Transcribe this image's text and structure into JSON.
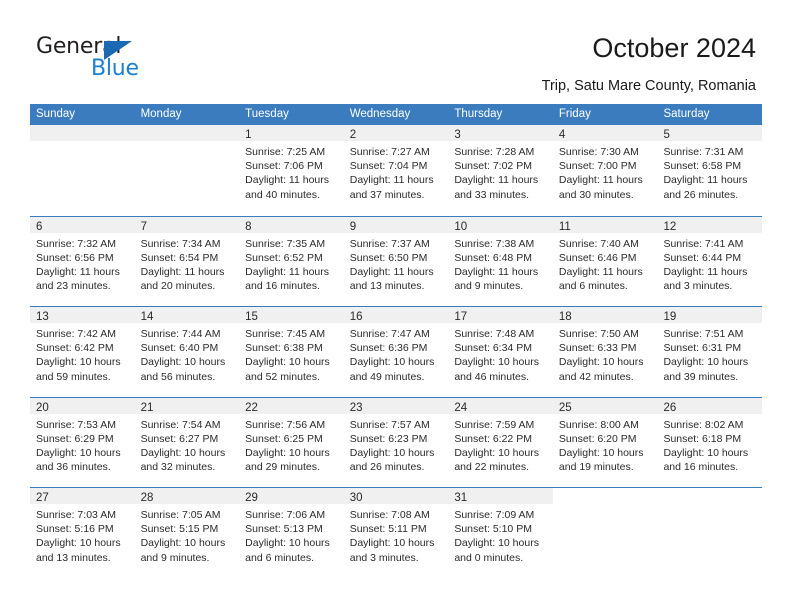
{
  "brand": {
    "name_top": "General",
    "name_bottom": "Blue",
    "accent_color": "#1b7fd4",
    "triangle_color": "#1b68b3"
  },
  "header": {
    "title": "October 2024",
    "subtitle": "Trip, Satu Mare County, Romania"
  },
  "calendar": {
    "header_bg": "#3a7cbe",
    "daynum_bg": "#f0f0f0",
    "weekday_headers": [
      "Sunday",
      "Monday",
      "Tuesday",
      "Wednesday",
      "Thursday",
      "Friday",
      "Saturday"
    ],
    "weeks": [
      [
        {
          "day": "",
          "lines": []
        },
        {
          "day": "",
          "lines": []
        },
        {
          "day": "1",
          "lines": [
            "Sunrise: 7:25 AM",
            "Sunset: 7:06 PM",
            "Daylight: 11 hours",
            "and 40 minutes."
          ]
        },
        {
          "day": "2",
          "lines": [
            "Sunrise: 7:27 AM",
            "Sunset: 7:04 PM",
            "Daylight: 11 hours",
            "and 37 minutes."
          ]
        },
        {
          "day": "3",
          "lines": [
            "Sunrise: 7:28 AM",
            "Sunset: 7:02 PM",
            "Daylight: 11 hours",
            "and 33 minutes."
          ]
        },
        {
          "day": "4",
          "lines": [
            "Sunrise: 7:30 AM",
            "Sunset: 7:00 PM",
            "Daylight: 11 hours",
            "and 30 minutes."
          ]
        },
        {
          "day": "5",
          "lines": [
            "Sunrise: 7:31 AM",
            "Sunset: 6:58 PM",
            "Daylight: 11 hours",
            "and 26 minutes."
          ]
        }
      ],
      [
        {
          "day": "6",
          "lines": [
            "Sunrise: 7:32 AM",
            "Sunset: 6:56 PM",
            "Daylight: 11 hours",
            "and 23 minutes."
          ]
        },
        {
          "day": "7",
          "lines": [
            "Sunrise: 7:34 AM",
            "Sunset: 6:54 PM",
            "Daylight: 11 hours",
            "and 20 minutes."
          ]
        },
        {
          "day": "8",
          "lines": [
            "Sunrise: 7:35 AM",
            "Sunset: 6:52 PM",
            "Daylight: 11 hours",
            "and 16 minutes."
          ]
        },
        {
          "day": "9",
          "lines": [
            "Sunrise: 7:37 AM",
            "Sunset: 6:50 PM",
            "Daylight: 11 hours",
            "and 13 minutes."
          ]
        },
        {
          "day": "10",
          "lines": [
            "Sunrise: 7:38 AM",
            "Sunset: 6:48 PM",
            "Daylight: 11 hours",
            "and 9 minutes."
          ]
        },
        {
          "day": "11",
          "lines": [
            "Sunrise: 7:40 AM",
            "Sunset: 6:46 PM",
            "Daylight: 11 hours",
            "and 6 minutes."
          ]
        },
        {
          "day": "12",
          "lines": [
            "Sunrise: 7:41 AM",
            "Sunset: 6:44 PM",
            "Daylight: 11 hours",
            "and 3 minutes."
          ]
        }
      ],
      [
        {
          "day": "13",
          "lines": [
            "Sunrise: 7:42 AM",
            "Sunset: 6:42 PM",
            "Daylight: 10 hours",
            "and 59 minutes."
          ]
        },
        {
          "day": "14",
          "lines": [
            "Sunrise: 7:44 AM",
            "Sunset: 6:40 PM",
            "Daylight: 10 hours",
            "and 56 minutes."
          ]
        },
        {
          "day": "15",
          "lines": [
            "Sunrise: 7:45 AM",
            "Sunset: 6:38 PM",
            "Daylight: 10 hours",
            "and 52 minutes."
          ]
        },
        {
          "day": "16",
          "lines": [
            "Sunrise: 7:47 AM",
            "Sunset: 6:36 PM",
            "Daylight: 10 hours",
            "and 49 minutes."
          ]
        },
        {
          "day": "17",
          "lines": [
            "Sunrise: 7:48 AM",
            "Sunset: 6:34 PM",
            "Daylight: 10 hours",
            "and 46 minutes."
          ]
        },
        {
          "day": "18",
          "lines": [
            "Sunrise: 7:50 AM",
            "Sunset: 6:33 PM",
            "Daylight: 10 hours",
            "and 42 minutes."
          ]
        },
        {
          "day": "19",
          "lines": [
            "Sunrise: 7:51 AM",
            "Sunset: 6:31 PM",
            "Daylight: 10 hours",
            "and 39 minutes."
          ]
        }
      ],
      [
        {
          "day": "20",
          "lines": [
            "Sunrise: 7:53 AM",
            "Sunset: 6:29 PM",
            "Daylight: 10 hours",
            "and 36 minutes."
          ]
        },
        {
          "day": "21",
          "lines": [
            "Sunrise: 7:54 AM",
            "Sunset: 6:27 PM",
            "Daylight: 10 hours",
            "and 32 minutes."
          ]
        },
        {
          "day": "22",
          "lines": [
            "Sunrise: 7:56 AM",
            "Sunset: 6:25 PM",
            "Daylight: 10 hours",
            "and 29 minutes."
          ]
        },
        {
          "day": "23",
          "lines": [
            "Sunrise: 7:57 AM",
            "Sunset: 6:23 PM",
            "Daylight: 10 hours",
            "and 26 minutes."
          ]
        },
        {
          "day": "24",
          "lines": [
            "Sunrise: 7:59 AM",
            "Sunset: 6:22 PM",
            "Daylight: 10 hours",
            "and 22 minutes."
          ]
        },
        {
          "day": "25",
          "lines": [
            "Sunrise: 8:00 AM",
            "Sunset: 6:20 PM",
            "Daylight: 10 hours",
            "and 19 minutes."
          ]
        },
        {
          "day": "26",
          "lines": [
            "Sunrise: 8:02 AM",
            "Sunset: 6:18 PM",
            "Daylight: 10 hours",
            "and 16 minutes."
          ]
        }
      ],
      [
        {
          "day": "27",
          "lines": [
            "Sunrise: 7:03 AM",
            "Sunset: 5:16 PM",
            "Daylight: 10 hours",
            "and 13 minutes."
          ]
        },
        {
          "day": "28",
          "lines": [
            "Sunrise: 7:05 AM",
            "Sunset: 5:15 PM",
            "Daylight: 10 hours",
            "and 9 minutes."
          ]
        },
        {
          "day": "29",
          "lines": [
            "Sunrise: 7:06 AM",
            "Sunset: 5:13 PM",
            "Daylight: 10 hours",
            "and 6 minutes."
          ]
        },
        {
          "day": "30",
          "lines": [
            "Sunrise: 7:08 AM",
            "Sunset: 5:11 PM",
            "Daylight: 10 hours",
            "and 3 minutes."
          ]
        },
        {
          "day": "31",
          "lines": [
            "Sunrise: 7:09 AM",
            "Sunset: 5:10 PM",
            "Daylight: 10 hours",
            "and 0 minutes."
          ]
        },
        {
          "day": "",
          "lines": [],
          "blank": true
        },
        {
          "day": "",
          "lines": [],
          "blank": true
        }
      ]
    ]
  }
}
